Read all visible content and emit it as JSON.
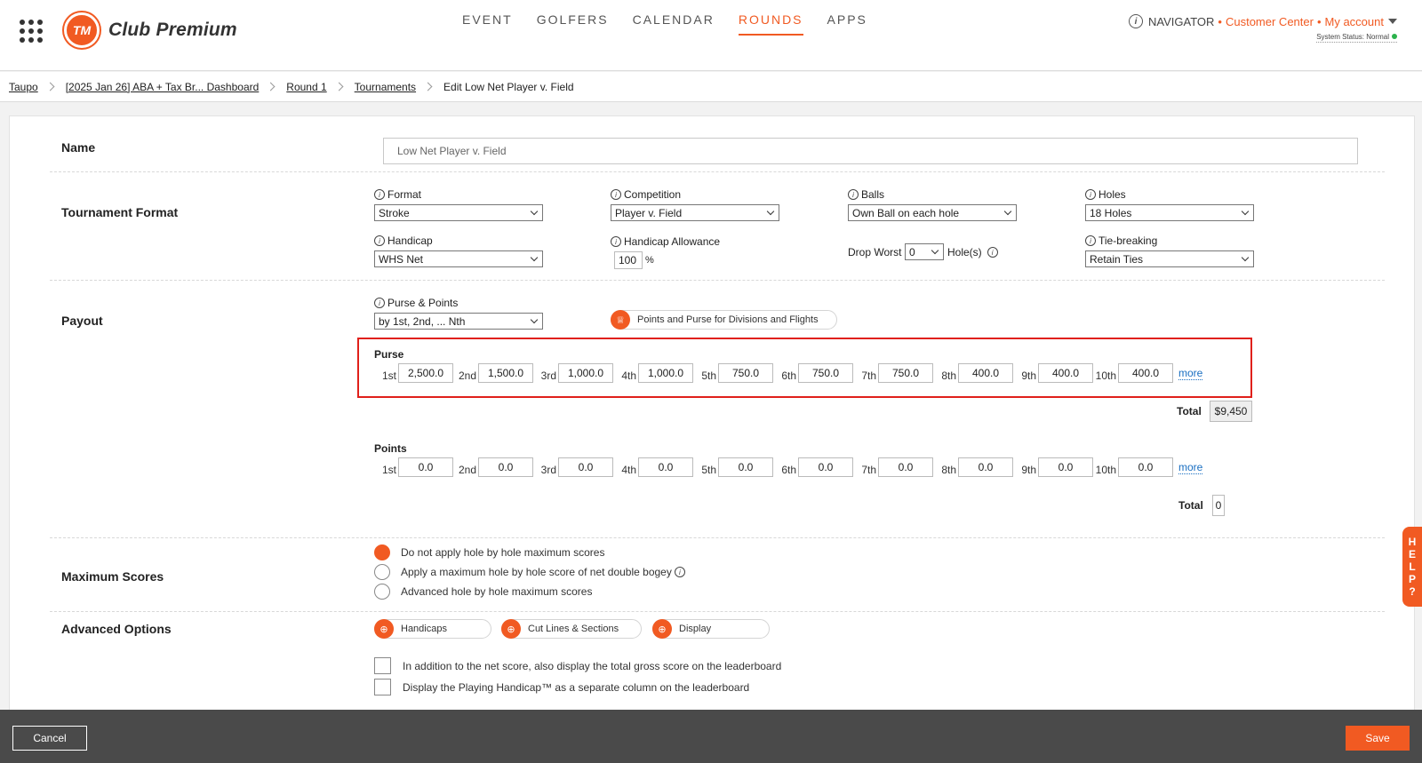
{
  "header": {
    "logo_mark": "TM",
    "logo_text": "Club Premium",
    "nav": [
      {
        "label": "EVENT"
      },
      {
        "label": "GOLFERS"
      },
      {
        "label": "CALENDAR"
      },
      {
        "label": "ROUNDS",
        "active": true
      },
      {
        "label": "APPS"
      }
    ],
    "navigator": "NAVIGATOR",
    "customer_center": "Customer Center",
    "my_account": "My account",
    "system_status": "System Status: Normal",
    "sep": "•"
  },
  "breadcrumb": [
    "Taupo",
    "[2025 Jan 26] ABA + Tax Br... Dashboard",
    "Round 1",
    "Tournaments"
  ],
  "breadcrumb_current": "Edit Low Net Player v. Field",
  "name_section": {
    "label": "Name",
    "value": "Low Net  Player v. Field"
  },
  "format_section": {
    "label": "Tournament Format",
    "format": {
      "label": "Format",
      "value": "Stroke"
    },
    "competition": {
      "label": "Competition",
      "value": "Player v. Field"
    },
    "balls": {
      "label": "Balls",
      "value": "Own Ball on each hole"
    },
    "holes": {
      "label": "Holes",
      "value": "18 Holes"
    },
    "handicap": {
      "label": "Handicap",
      "value": "WHS Net"
    },
    "allowance": {
      "label": "Handicap Allowance",
      "value": "100",
      "unit": "%"
    },
    "drop_worst": {
      "label": "Drop Worst",
      "value": "0",
      "suffix": "Hole(s)"
    },
    "tiebreak": {
      "label": "Tie-breaking",
      "value": "Retain Ties"
    }
  },
  "payout": {
    "label": "Payout",
    "purse_points": {
      "label": "Purse & Points",
      "value": "by 1st, 2nd, ... Nth"
    },
    "divisions_button": "Points and Purse for Divisions and Flights",
    "purse_title": "Purse",
    "purse": [
      {
        "place": "1st",
        "value": "2,500.0"
      },
      {
        "place": "2nd",
        "value": "1,500.0"
      },
      {
        "place": "3rd",
        "value": "1,000.0"
      },
      {
        "place": "4th",
        "value": "1,000.0"
      },
      {
        "place": "5th",
        "value": "750.0"
      },
      {
        "place": "6th",
        "value": "750.0"
      },
      {
        "place": "7th",
        "value": "750.0"
      },
      {
        "place": "8th",
        "value": "400.0"
      },
      {
        "place": "9th",
        "value": "400.0"
      },
      {
        "place": "10th",
        "value": "400.0"
      }
    ],
    "more": "more",
    "total_label": "Total",
    "purse_total": "$9,450",
    "points_title": "Points",
    "points": [
      {
        "place": "1st",
        "value": "0.0"
      },
      {
        "place": "2nd",
        "value": "0.0"
      },
      {
        "place": "3rd",
        "value": "0.0"
      },
      {
        "place": "4th",
        "value": "0.0"
      },
      {
        "place": "5th",
        "value": "0.0"
      },
      {
        "place": "6th",
        "value": "0.0"
      },
      {
        "place": "7th",
        "value": "0.0"
      },
      {
        "place": "8th",
        "value": "0.0"
      },
      {
        "place": "9th",
        "value": "0.0"
      },
      {
        "place": "10th",
        "value": "0.0"
      }
    ],
    "points_total": "0"
  },
  "max_scores": {
    "label": "Maximum Scores",
    "options": [
      {
        "label": "Do not apply hole by hole maximum scores",
        "selected": true
      },
      {
        "label": "Apply a maximum hole by hole score of net double bogey",
        "selected": false
      },
      {
        "label": "Advanced hole by hole maximum scores",
        "selected": false
      }
    ]
  },
  "advanced": {
    "label": "Advanced Options",
    "buttons": [
      "Handicaps",
      "Cut Lines & Sections",
      "Display"
    ],
    "checks": [
      "In addition to the net score, also display the total gross score on the leaderboard",
      "Display the Playing Handicap™ as a separate column on the leaderboard"
    ]
  },
  "help": [
    "H",
    "E",
    "L",
    "P",
    "?"
  ],
  "footer": {
    "cancel": "Cancel",
    "save": "Save"
  },
  "colors": {
    "accent": "#f15a22",
    "highlight_border": "#e0201b",
    "link": "#1a6fc2",
    "footer": "#4a4a4a"
  }
}
